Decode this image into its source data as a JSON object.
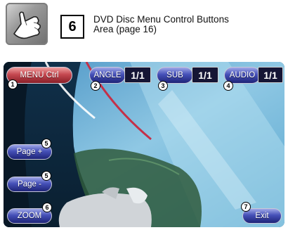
{
  "header": {
    "hand_icon": "hand-pointing-icon",
    "step_number": "6",
    "description_line1": "DVD Disc Menu Control Buttons",
    "description_line2": "Area (page 16)"
  },
  "buttons": {
    "menu_ctrl": "MENU Ctrl",
    "angle": "ANGLE",
    "angle_value": "1/1",
    "sub": "SUB",
    "sub_value": "1/1",
    "audio": "AUDIO",
    "audio_value": "1/1",
    "page_plus": "Page +",
    "page_minus": "Page -",
    "zoom": "ZOOM",
    "exit": "Exit"
  },
  "callouts": {
    "c1": "1",
    "c2": "2",
    "c3": "3",
    "c4": "4",
    "c5a": "5",
    "c5b": "5",
    "c6": "6",
    "c7": "7"
  },
  "colors": {
    "red_button": "#c54850",
    "blue_button": "#4550b8",
    "screen_background": "#1a3d5a"
  }
}
